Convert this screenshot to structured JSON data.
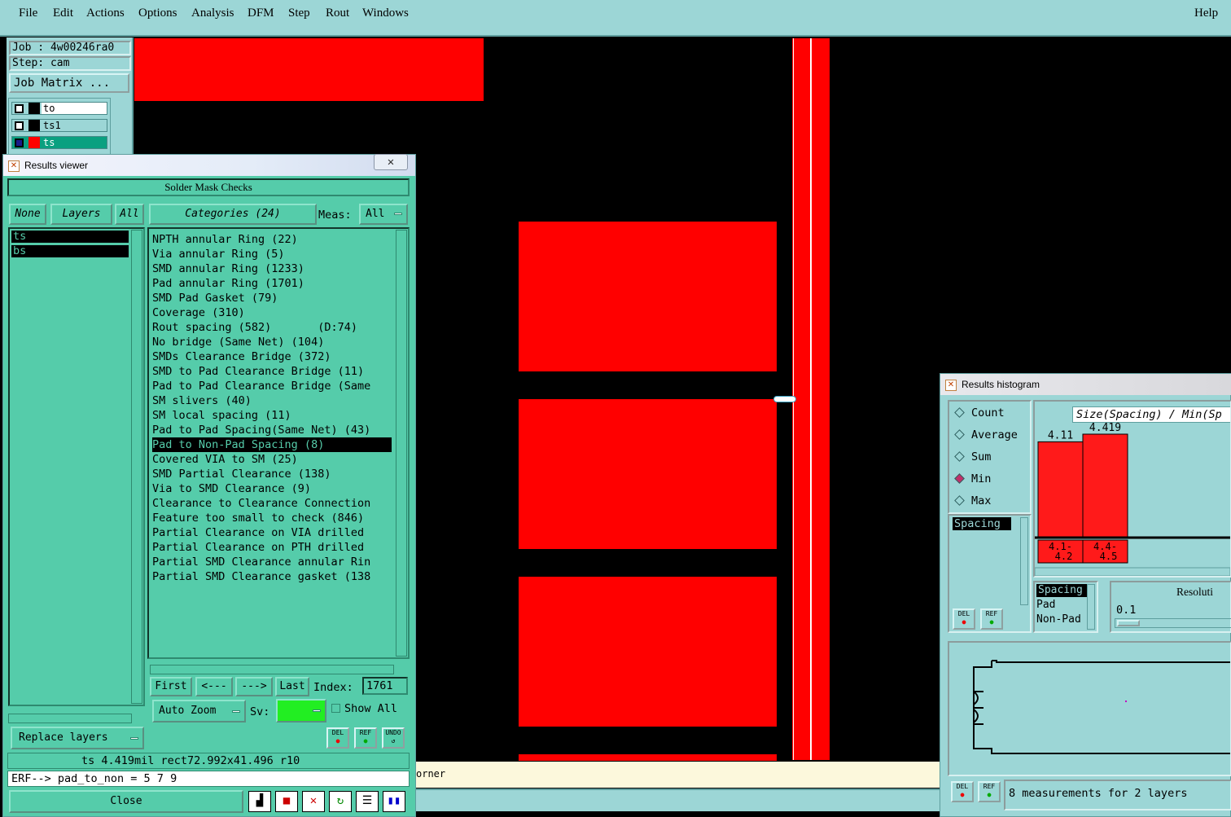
{
  "menu": [
    "File",
    "Edit",
    "Actions",
    "Options",
    "Analysis",
    "DFM",
    "Step",
    "Rout",
    "Windows"
  ],
  "help": "Help",
  "job": {
    "job_label": "Job : 4w00246ra0",
    "step_label": "Step: cam",
    "matrix_button": "Job Matrix ..."
  },
  "layers": [
    {
      "name": "to",
      "color": "#000000"
    },
    {
      "name": "ts1",
      "color": "#000000"
    },
    {
      "name": "ts",
      "color": "#ff0000"
    }
  ],
  "results_viewer": {
    "title": "Results viewer",
    "header": "Solder Mask Checks",
    "btn_none": "None",
    "btn_layers": "Layers",
    "btn_all": "All",
    "categories_label": "Categories (24)",
    "meas_label": "Meas:",
    "meas_value": "All",
    "layer_items": [
      "ts",
      "bs"
    ],
    "categories": [
      "NPTH annular Ring (22)",
      "Via annular Ring (5)",
      "SMD annular Ring (1233)",
      "Pad annular Ring (1701)",
      "SMD Pad Gasket (79)",
      "Coverage (310)",
      "Rout spacing (582)       (D:74)",
      "No bridge (Same Net) (104)",
      "SMDs Clearance Bridge (372)",
      "SMD to Pad Clearance Bridge (11)",
      "Pad to Pad Clearance Bridge (Same",
      "SM slivers (40)",
      "SM local spacing (11)",
      "Pad to Pad Spacing(Same Net) (43)",
      "Pad to Non-Pad Spacing (8)",
      "Covered VIA to SM (25)",
      "SMD Partial Clearance (138)",
      "Via to SMD Clearance (9)",
      "Clearance to Clearance Connection",
      "Feature too small to check (846)",
      "Partial Clearance on VIA drilled",
      "Partial Clearance on PTH drilled",
      "Partial SMD Clearance annular Rin",
      "Partial SMD Clearance gasket (138"
    ],
    "selected_index": 14,
    "nav": {
      "first": "First",
      "prev": "<---",
      "next": "--->",
      "last": "Last",
      "index_label": "Index:",
      "index_value": "1761"
    },
    "auto_zoom": "Auto Zoom",
    "sv_label": "Sv:",
    "show_all": "Show All",
    "replace_layers": "Replace layers",
    "icons": {
      "del": "DEL",
      "ref": "REF",
      "undo": "UNDO"
    },
    "status": "ts 4.419mil  rect72.992x41.496  r10",
    "erf": "ERF--> pad_to_non = 5 7 9",
    "close": "Close"
  },
  "canvas_bottom_text": "orner",
  "histogram": {
    "title": "Results histogram",
    "modes": [
      "Count",
      "Average",
      "Sum",
      "Min",
      "Max"
    ],
    "selected_mode": "Min",
    "chart_title": "Size(Spacing) / Min(Sp",
    "spacing_item": "Spacing",
    "filter_items": [
      "Spacing",
      "Pad",
      "Non-Pad"
    ],
    "resolution_label": "Resoluti",
    "resolution_value": "0.1",
    "footer": "8 measurements for 2 layers",
    "chart_data": {
      "type": "bar",
      "categories": [
        "4.1-4.2",
        "4.4-4.5"
      ],
      "values": [
        4.11,
        4.419
      ]
    }
  }
}
